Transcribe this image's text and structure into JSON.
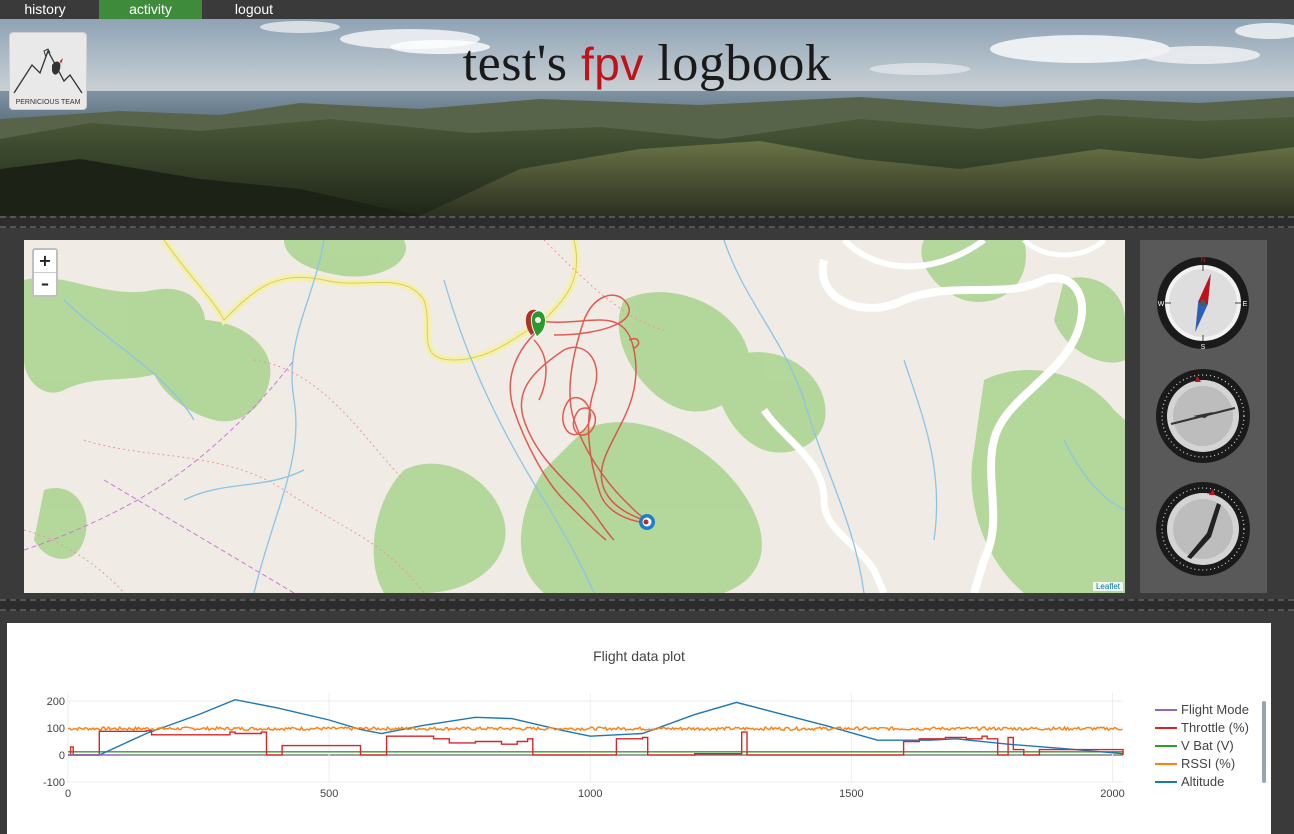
{
  "nav": {
    "tabs": [
      {
        "label": "history",
        "active": false
      },
      {
        "label": "activity",
        "active": true
      },
      {
        "label": "logout",
        "active": false
      }
    ]
  },
  "header": {
    "title_prefix": "test's",
    "title_accent": "fpv",
    "title_suffix": "logbook",
    "logo_text": "PERNICIOUS TEAM"
  },
  "map": {
    "zoom_in_label": "+",
    "zoom_out_label": "–",
    "attribution": "Leaflet"
  },
  "instruments": {
    "compass_labels": {
      "n": "N",
      "e": "E",
      "s": "S",
      "w": "W"
    }
  },
  "chart_data": {
    "type": "line",
    "title": "Flight data plot",
    "xlim": [
      0,
      2020
    ],
    "ylim": [
      -100,
      230
    ],
    "x_ticks": [
      0,
      500,
      1000,
      1500,
      2000
    ],
    "y_ticks": [
      -100,
      0,
      100,
      200
    ],
    "legend_position": "right",
    "series": [
      {
        "name": "Flight Mode",
        "color": "#9467bd",
        "x": [
          0,
          100
        ],
        "y": [
          0,
          0
        ]
      },
      {
        "name": "Throttle (%)",
        "color": "#d62728",
        "x": [
          0,
          5,
          10,
          50,
          60,
          150,
          160,
          310,
          320,
          370,
          380,
          400,
          410,
          550,
          560,
          600,
          610,
          700,
          730,
          780,
          830,
          860,
          880,
          890,
          1000,
          1050,
          1100,
          1110,
          1200,
          1290,
          1300,
          1540,
          1600,
          1630,
          1680,
          1720,
          1750,
          1760,
          1780,
          1800,
          1810,
          1830,
          1850,
          1860,
          2020
        ],
        "y": [
          0,
          30,
          0,
          0,
          88,
          90,
          75,
          85,
          80,
          85,
          0,
          0,
          35,
          35,
          0,
          0,
          70,
          60,
          45,
          50,
          40,
          50,
          60,
          0,
          0,
          60,
          65,
          0,
          5,
          85,
          0,
          0,
          50,
          60,
          65,
          60,
          70,
          60,
          0,
          65,
          20,
          0,
          0,
          20,
          0
        ]
      },
      {
        "name": "V Bat (V)",
        "color": "#2ca02c",
        "x": [
          0,
          2020
        ],
        "y": [
          12,
          12
        ]
      },
      {
        "name": "RSSI (%)",
        "color": "#ff7f0e",
        "x": [
          0,
          2020
        ],
        "y": [
          98,
          98
        ],
        "noise": 12
      },
      {
        "name": "Altitude",
        "color": "#1f77b4",
        "x": [
          0,
          60,
          150,
          250,
          320,
          400,
          500,
          560,
          600,
          680,
          780,
          850,
          950,
          1000,
          1100,
          1200,
          1280,
          1350,
          1450,
          1550,
          1650,
          1700,
          1800,
          1900,
          2020
        ],
        "y": [
          0,
          0,
          80,
          150,
          205,
          175,
          130,
          95,
          80,
          110,
          140,
          135,
          90,
          70,
          80,
          150,
          195,
          160,
          110,
          55,
          55,
          60,
          40,
          25,
          5
        ]
      }
    ]
  }
}
